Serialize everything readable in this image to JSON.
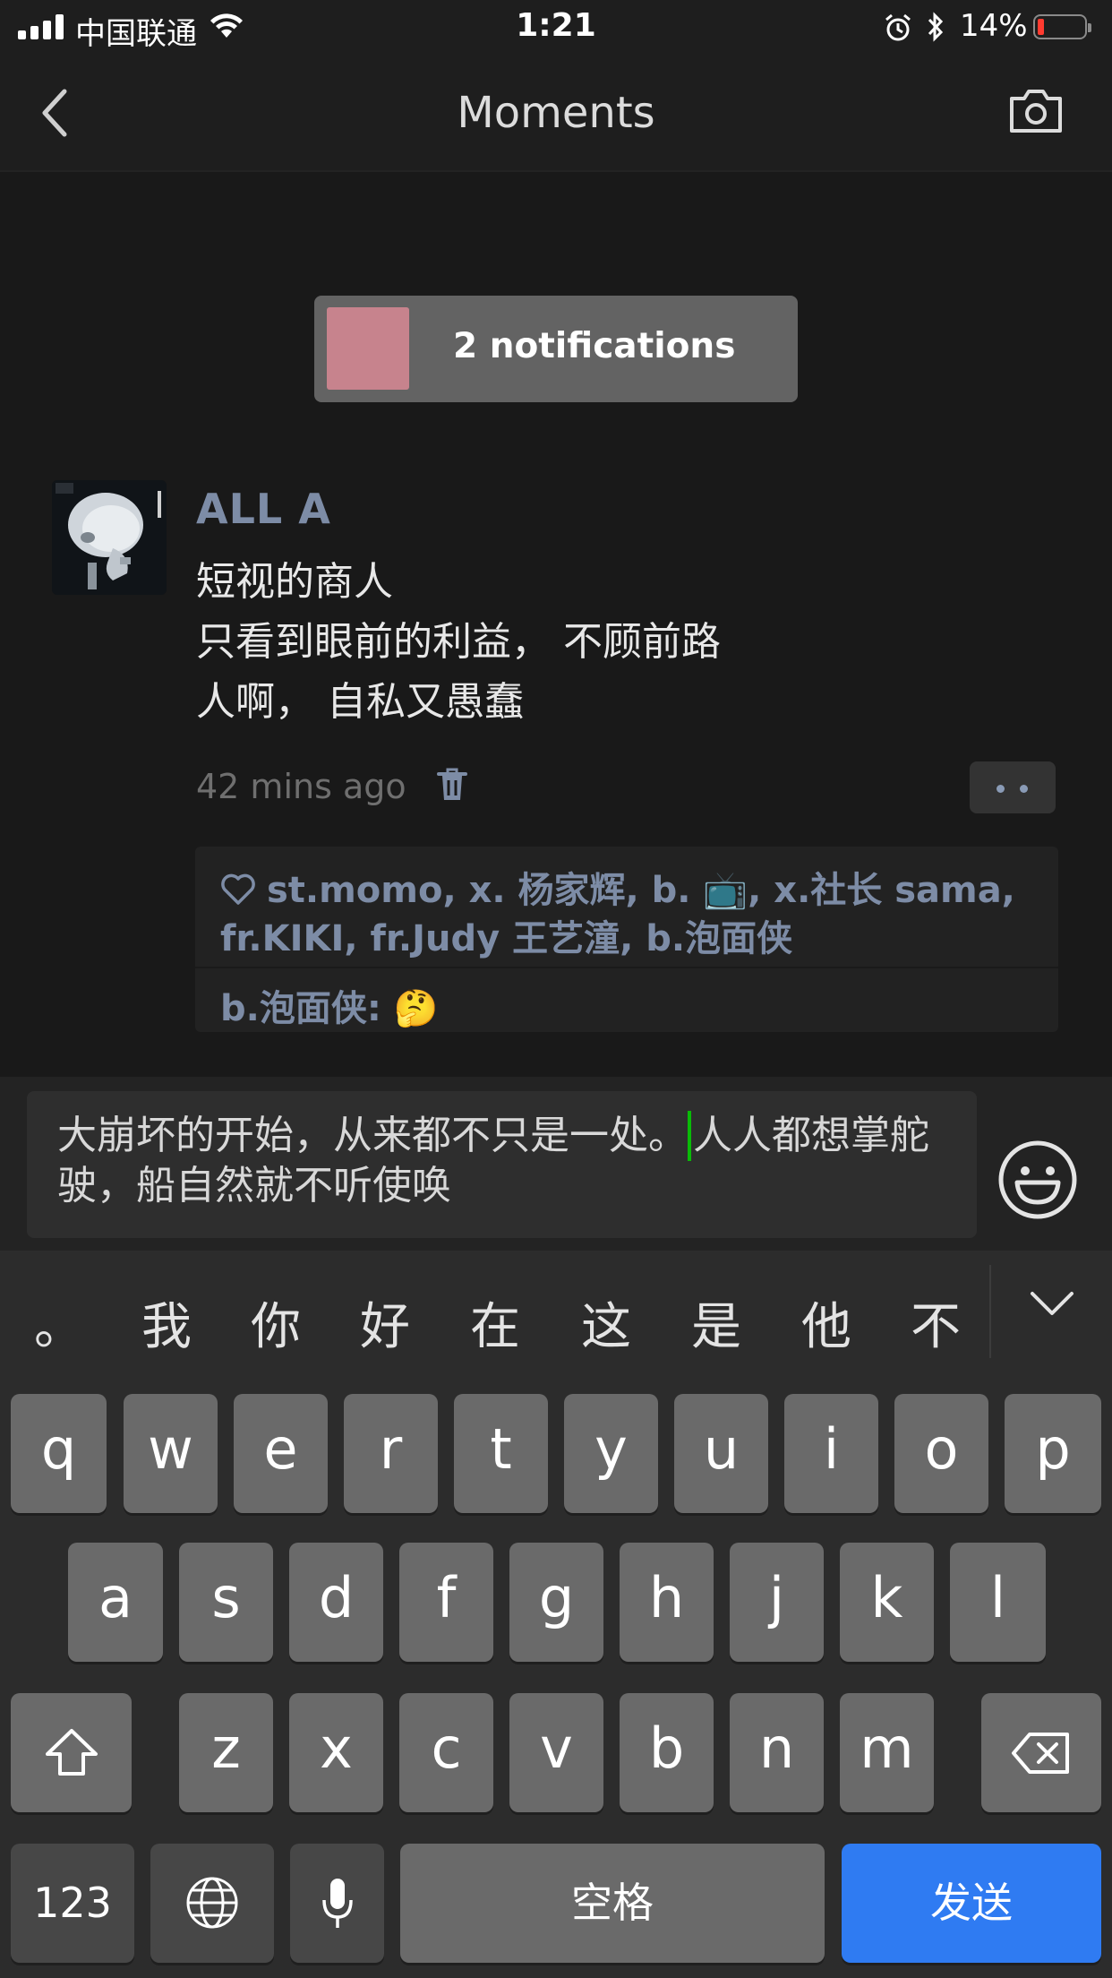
{
  "status_bar": {
    "carrier": "中国联通",
    "time": "1:21",
    "battery_percent": "14%",
    "battery_level": 0.14,
    "icons": [
      "signal-icon",
      "wifi-icon",
      "alarm-icon",
      "bluetooth-icon",
      "battery-icon"
    ]
  },
  "nav": {
    "title": "Moments",
    "back_icon": "chevron-left-icon",
    "camera_icon": "camera-icon"
  },
  "notification": {
    "text": "2 notifications"
  },
  "post": {
    "username": "ALL  A",
    "lines": [
      "短视的商人",
      "只看到眼前的利益， 不顾前路",
      "人啊， 自私又愚蠢"
    ],
    "time": "42 mins ago",
    "likes_line1": "st.momo, x. 杨家辉, b. 📺, x.社长 sama,",
    "likes_line2": "fr.KIKI, fr.Judy 王艺潼, b.泡面侠",
    "comment_author": "b.泡面侠:",
    "comment_text": "🤔"
  },
  "composer": {
    "text_before_caret": "大崩坏的开始，从来都不只是一处。",
    "text_after_caret": "人人都想掌舵驶，船自然就不听使唤"
  },
  "keyboard": {
    "candidates": [
      "。",
      "我",
      "你",
      "好",
      "在",
      "这",
      "是",
      "他",
      "不"
    ],
    "row1": [
      "q",
      "w",
      "e",
      "r",
      "t",
      "y",
      "u",
      "i",
      "o",
      "p"
    ],
    "row2": [
      "a",
      "s",
      "d",
      "f",
      "g",
      "h",
      "j",
      "k",
      "l"
    ],
    "row3": [
      "z",
      "x",
      "c",
      "v",
      "b",
      "n",
      "m"
    ],
    "numbers_label": "123",
    "space_label": "空格",
    "send_label": "发送",
    "accent_color": "#2f7bf2"
  }
}
